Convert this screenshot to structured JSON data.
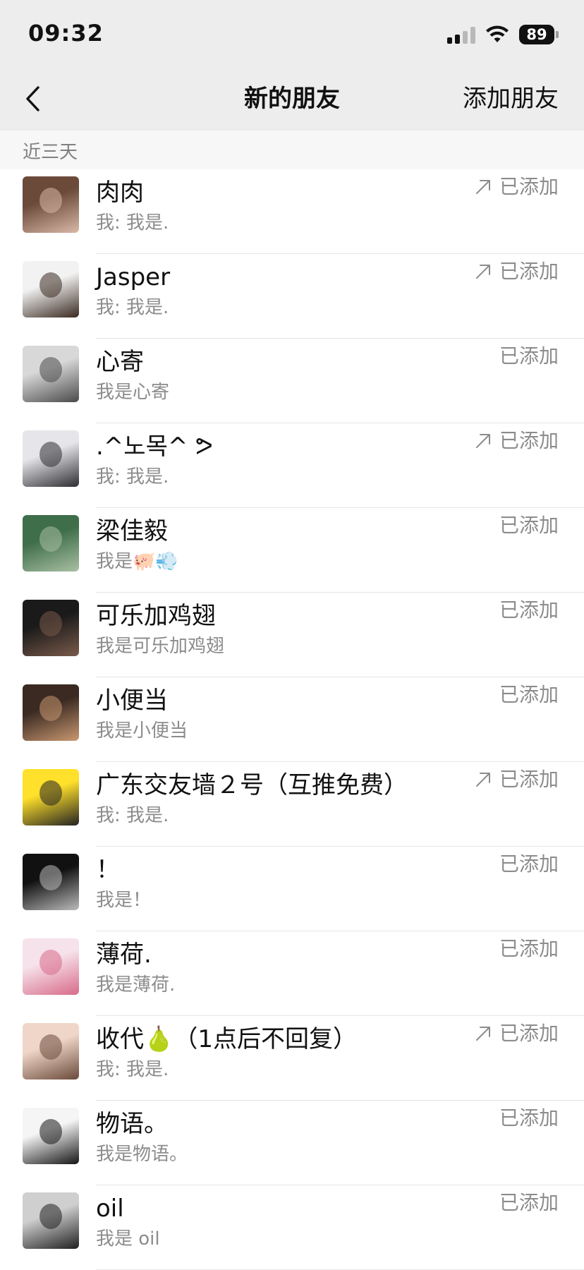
{
  "status_bar": {
    "time": "09:32",
    "battery": "89"
  },
  "nav": {
    "title": "新的朋友",
    "action": "添加朋友"
  },
  "section": {
    "label": "近三天"
  },
  "friends": [
    {
      "name": "肉肉",
      "message": "我: 我是.",
      "status": "已添加",
      "outgoing": true,
      "avatar_colors": [
        "#6b4a3a",
        "#d9b8a8"
      ]
    },
    {
      "name": "Jasper",
      "message": "我: 我是.",
      "status": "已添加",
      "outgoing": true,
      "avatar_colors": [
        "#f2f2f2",
        "#3a2a20"
      ]
    },
    {
      "name": "心寄",
      "message": "我是心寄",
      "status": "已添加",
      "outgoing": false,
      "avatar_colors": [
        "#d8d8d8",
        "#4a4a4a"
      ]
    },
    {
      "name": ".^노목^ ᕗ",
      "message": "我: 我是.",
      "status": "已添加",
      "outgoing": true,
      "avatar_colors": [
        "#e6e6ea",
        "#2e2e32"
      ]
    },
    {
      "name": "梁佳毅",
      "message": "我是🐖💨",
      "status": "已添加",
      "outgoing": false,
      "avatar_colors": [
        "#3f6e4a",
        "#a9c0a3"
      ]
    },
    {
      "name": "可乐加鸡翅",
      "message": "我是可乐加鸡翅",
      "status": "已添加",
      "outgoing": false,
      "avatar_colors": [
        "#1a1a1a",
        "#7a5a4a"
      ]
    },
    {
      "name": "小便当",
      "message": "我是小便当",
      "status": "已添加",
      "outgoing": false,
      "avatar_colors": [
        "#3a2a22",
        "#c99870"
      ]
    },
    {
      "name": "广东交友墙２号（互推免费）",
      "message": "我: 我是.",
      "status": "已添加",
      "outgoing": true,
      "avatar_colors": [
        "#ffe02a",
        "#222222"
      ]
    },
    {
      "name": "！",
      "message": "我是！",
      "status": "已添加",
      "outgoing": false,
      "avatar_colors": [
        "#111111",
        "#bbbbbb"
      ]
    },
    {
      "name": "薄荷.",
      "message": "我是薄荷.",
      "status": "已添加",
      "outgoing": false,
      "avatar_colors": [
        "#f6e2ea",
        "#d86a8a"
      ]
    },
    {
      "name": "收代🍐（1点后不回复）",
      "message": "我: 我是.",
      "status": "已添加",
      "outgoing": true,
      "avatar_colors": [
        "#f0d6c8",
        "#6a4a3a"
      ]
    },
    {
      "name": "物语。",
      "message": "我是物语。",
      "status": "已添加",
      "outgoing": false,
      "avatar_colors": [
        "#f5f5f5",
        "#151515"
      ]
    },
    {
      "name": "oil",
      "message": "我是 oil",
      "status": "已添加",
      "outgoing": false,
      "avatar_colors": [
        "#cfcfcf",
        "#202020"
      ]
    }
  ]
}
